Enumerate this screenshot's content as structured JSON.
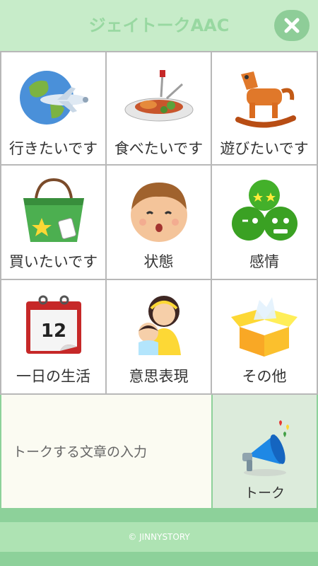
{
  "header": {
    "title": "ジェイトークAAC",
    "close_icon": "close-icon"
  },
  "categories": [
    {
      "label": "行きたいです",
      "icon": "airplane-globe-icon"
    },
    {
      "label": "食べたいです",
      "icon": "meal-plate-icon"
    },
    {
      "label": "遊びたいです",
      "icon": "rocking-horse-icon"
    },
    {
      "label": "買いたいです",
      "icon": "shopping-bag-icon"
    },
    {
      "label": "状態",
      "icon": "boy-face-icon"
    },
    {
      "label": "感情",
      "icon": "emotion-faces-icon"
    },
    {
      "label": "一日の生活",
      "icon": "calendar-icon"
    },
    {
      "label": "意思表現",
      "icon": "mother-child-icon"
    },
    {
      "label": "その他",
      "icon": "open-box-icon"
    }
  ],
  "calendar_day": "12",
  "input": {
    "placeholder": "トークする文章の入力"
  },
  "talk_button": {
    "label": "トーク",
    "icon": "megaphone-icon"
  },
  "footer": {
    "copyright": "© JINNYSTORY"
  },
  "colors": {
    "header_bg": "#c7ecc9",
    "accent_green": "#8dd19a",
    "title_text": "#98d8a1"
  }
}
